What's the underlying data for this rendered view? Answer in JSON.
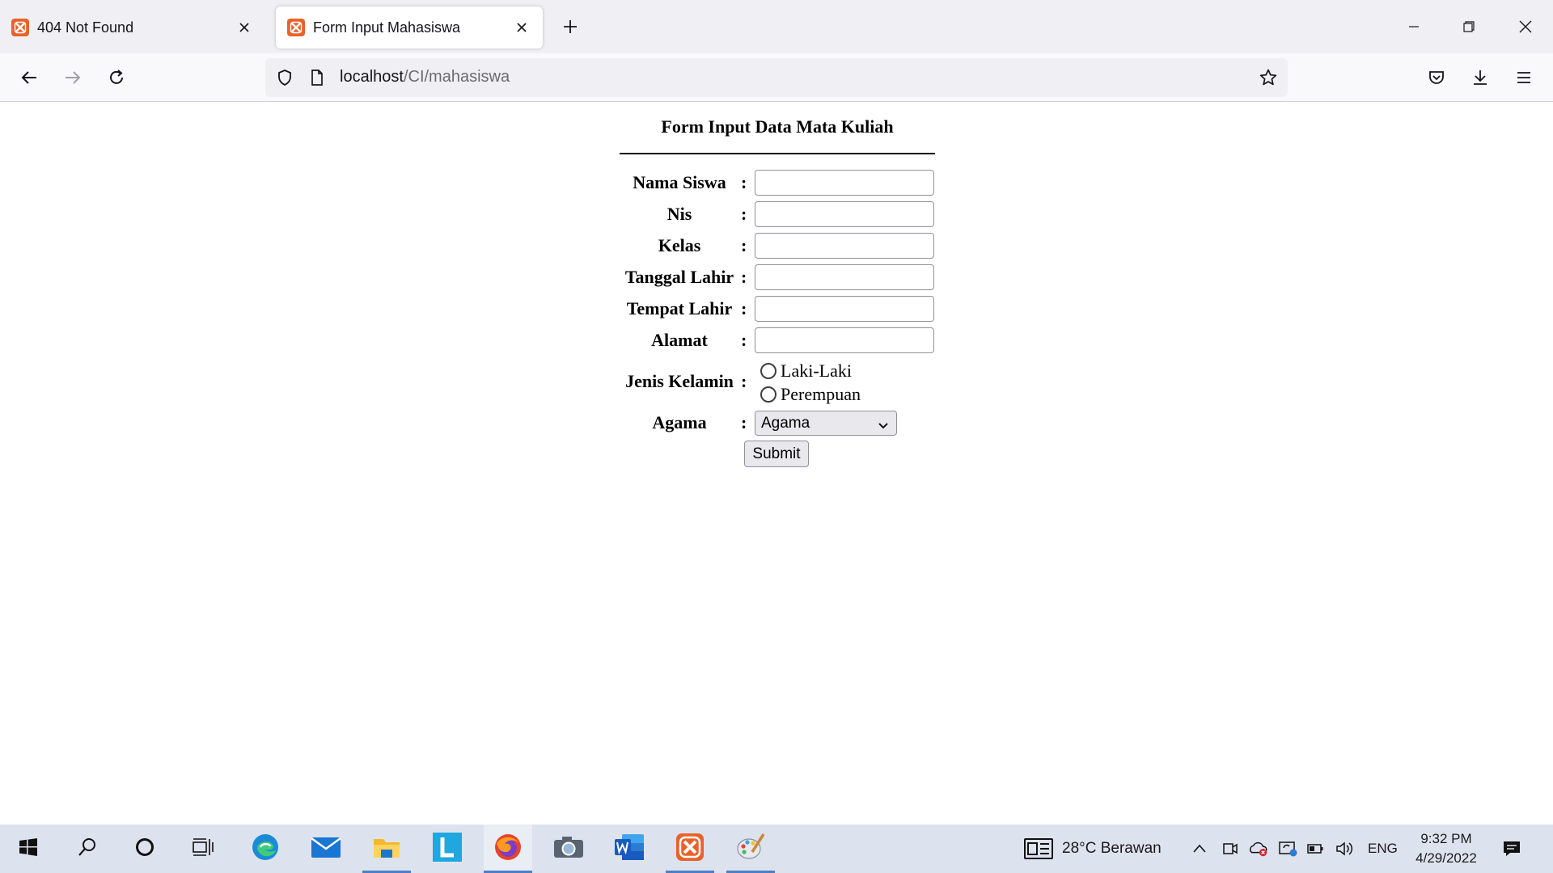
{
  "browser": {
    "tabs": [
      {
        "title": "404 Not Found",
        "active": false
      },
      {
        "title": "Form Input Mahasiswa",
        "active": true
      }
    ],
    "url_host": "localhost",
    "url_path": "/CI/mahasiswa"
  },
  "form": {
    "title": "Form Input Data Mata Kuliah",
    "colon": ":",
    "fields": [
      {
        "label": "Nama Siswa",
        "value": ""
      },
      {
        "label": "Nis",
        "value": ""
      },
      {
        "label": "Kelas",
        "value": ""
      },
      {
        "label": "Tanggal Lahir",
        "value": ""
      },
      {
        "label": "Tempat Lahir",
        "value": ""
      },
      {
        "label": "Alamat",
        "value": ""
      }
    ],
    "gender": {
      "label": "Jenis Kelamin",
      "options": [
        "Laki-Laki",
        "Perempuan"
      ]
    },
    "religion": {
      "label": "Agama",
      "selected": "Agama"
    },
    "submit_label": "Submit"
  },
  "taskbar": {
    "apps": [
      "start-icon",
      "search-icon",
      "cortana-icon",
      "task-view-icon",
      "edge-icon",
      "mail-icon",
      "file-explorer-icon",
      "l-app-icon",
      "firefox-icon",
      "camera-icon",
      "word-icon",
      "xampp-icon",
      "paint-icon"
    ],
    "weather": "28°C  Berawan",
    "language": "ENG",
    "time": "9:32 PM",
    "date": "4/29/2022"
  },
  "colors": {
    "accent_orange": "#e8632b",
    "taskbar": "#dde3ee",
    "running_indicator": "#4c7fc8"
  }
}
